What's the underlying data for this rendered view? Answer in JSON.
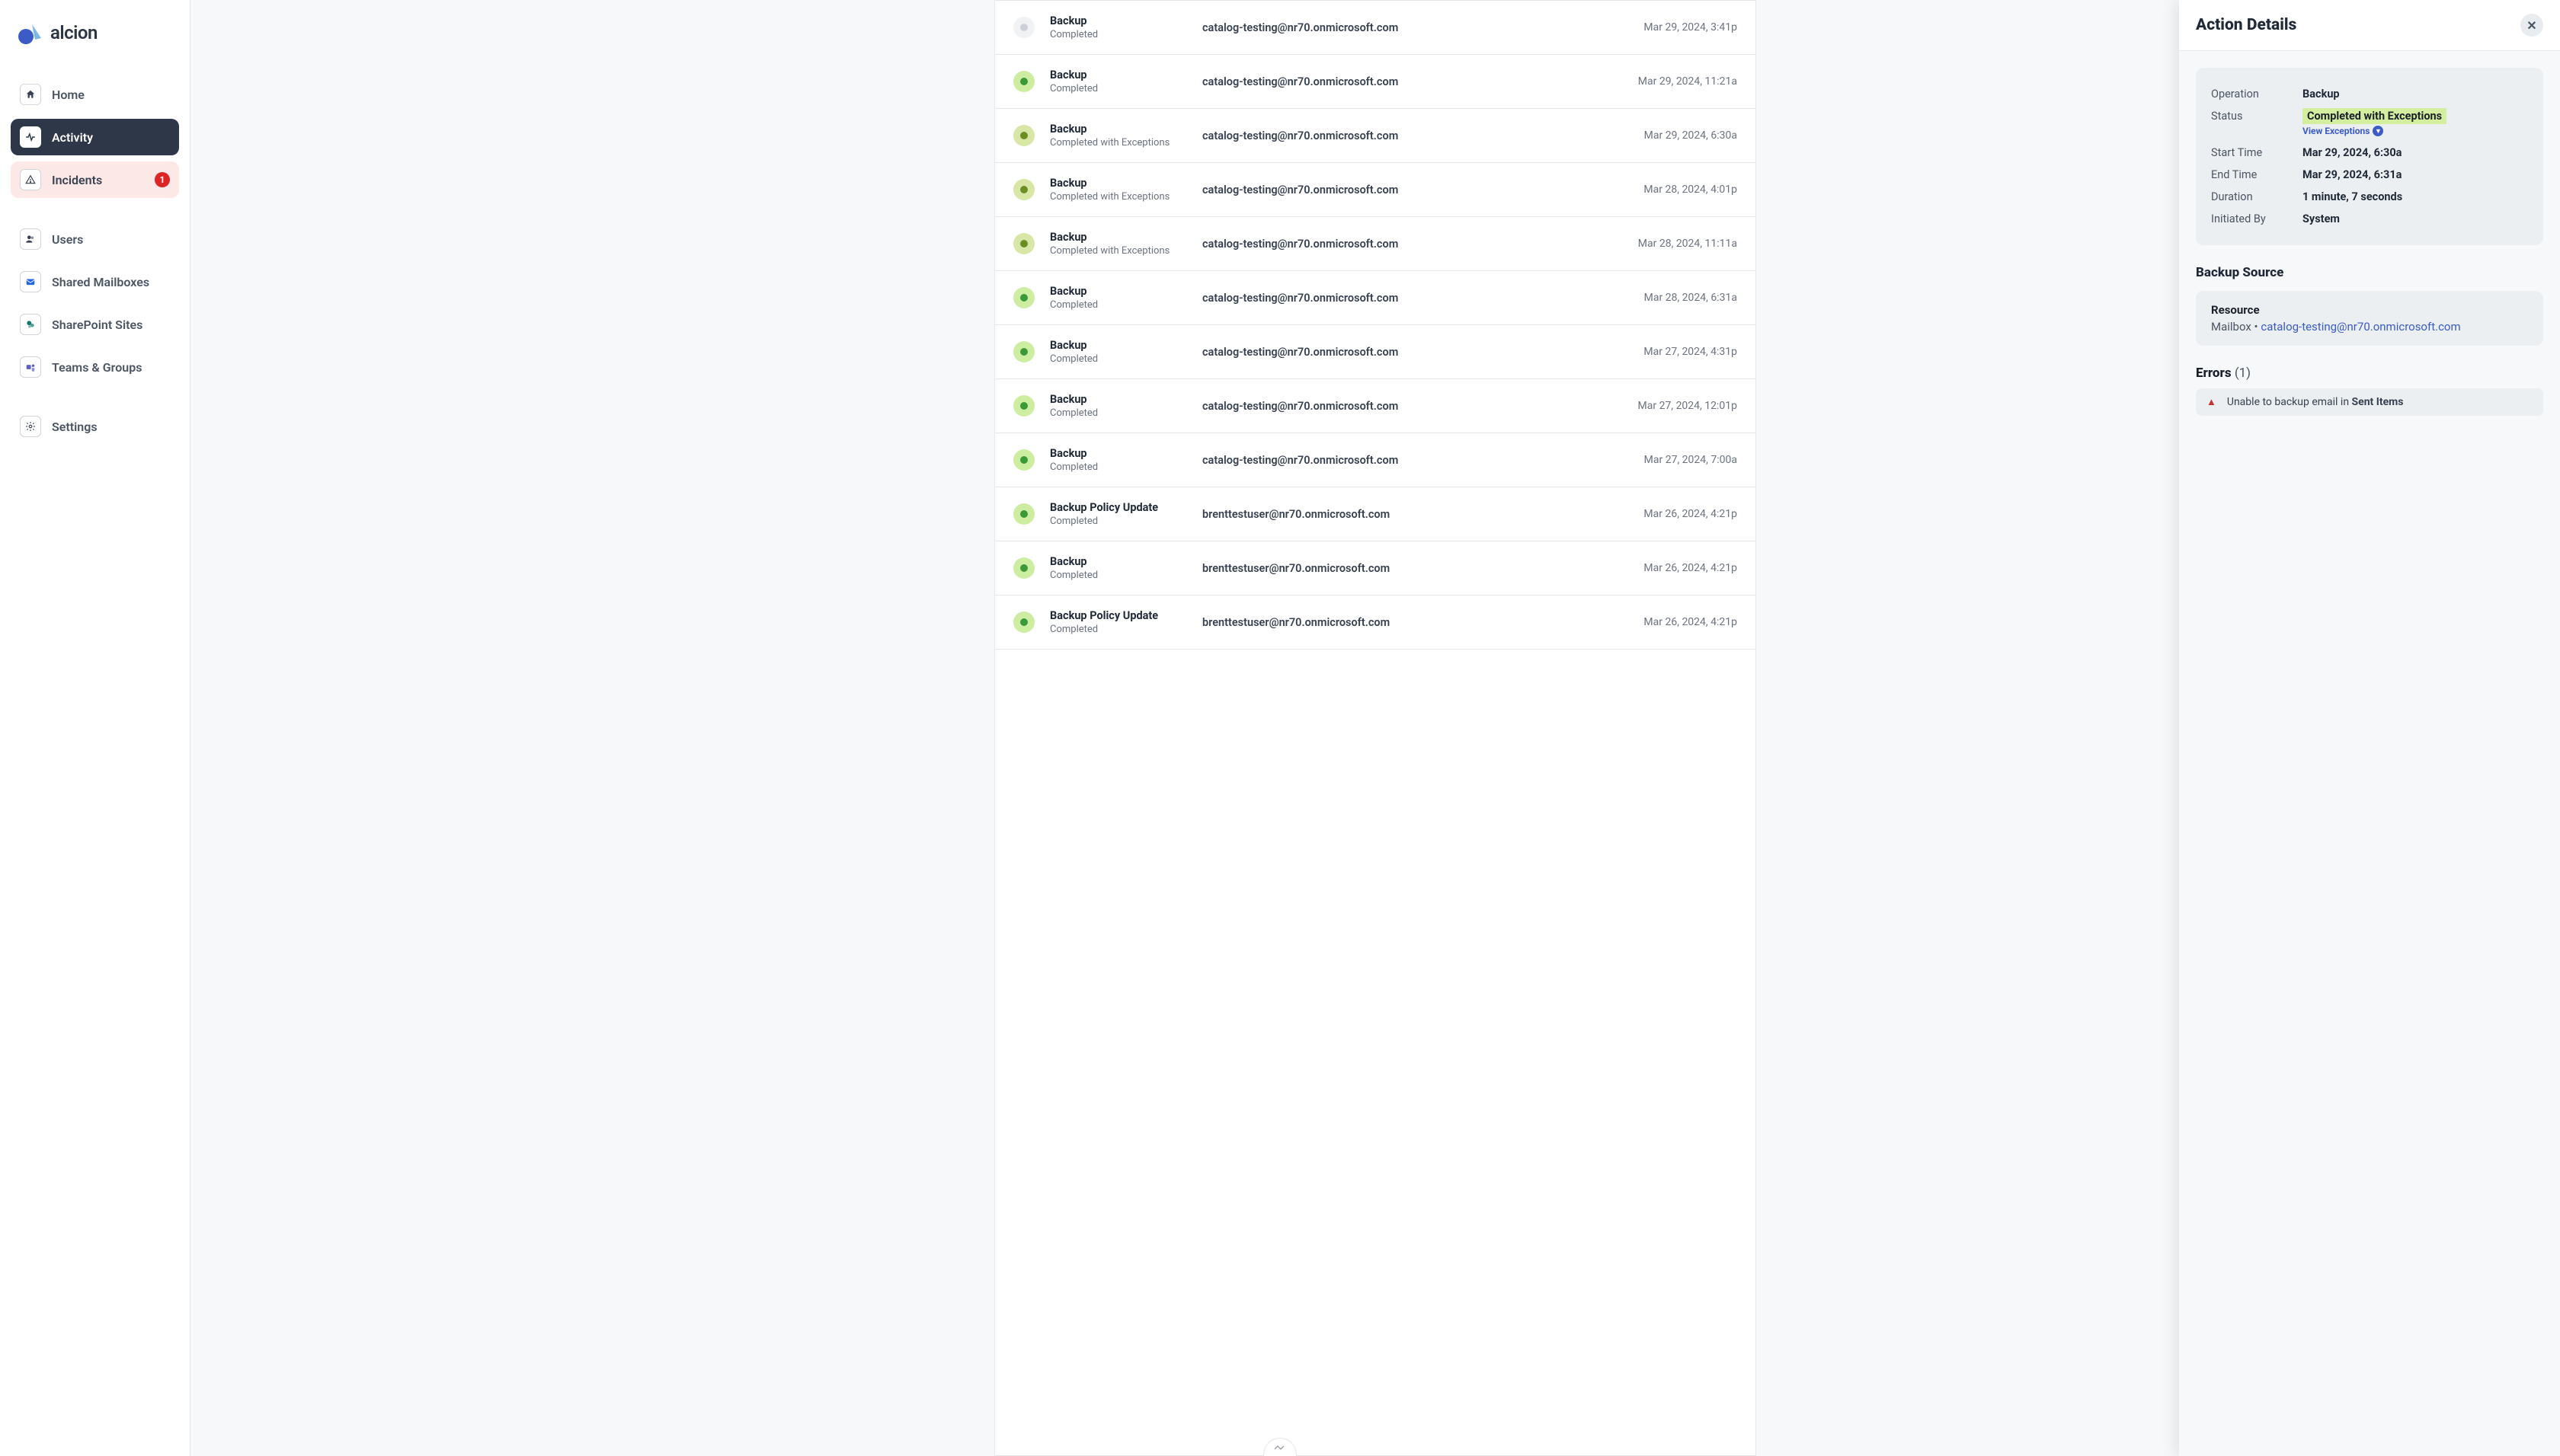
{
  "brand": "alcion",
  "sidebar": {
    "home": "Home",
    "activity": "Activity",
    "incidents": "Incidents",
    "incidents_badge": "1",
    "users": "Users",
    "shared_mailboxes": "Shared Mailboxes",
    "sharepoint_sites": "SharePoint Sites",
    "teams_groups": "Teams & Groups",
    "settings": "Settings"
  },
  "activity": [
    {
      "status": "faded",
      "title": "Backup",
      "subtitle": "Completed",
      "email": "catalog-testing@nr70.onmicrosoft.com",
      "time": "Mar 29, 2024, 3:41p"
    },
    {
      "status": "ok",
      "title": "Backup",
      "subtitle": "Completed",
      "email": "catalog-testing@nr70.onmicrosoft.com",
      "time": "Mar 29, 2024, 11:21a"
    },
    {
      "status": "warn",
      "title": "Backup",
      "subtitle": "Completed with Exceptions",
      "email": "catalog-testing@nr70.onmicrosoft.com",
      "time": "Mar 29, 2024, 6:30a"
    },
    {
      "status": "warn",
      "title": "Backup",
      "subtitle": "Completed with Exceptions",
      "email": "catalog-testing@nr70.onmicrosoft.com",
      "time": "Mar 28, 2024, 4:01p"
    },
    {
      "status": "warn",
      "title": "Backup",
      "subtitle": "Completed with Exceptions",
      "email": "catalog-testing@nr70.onmicrosoft.com",
      "time": "Mar 28, 2024, 11:11a"
    },
    {
      "status": "ok",
      "title": "Backup",
      "subtitle": "Completed",
      "email": "catalog-testing@nr70.onmicrosoft.com",
      "time": "Mar 28, 2024, 6:31a"
    },
    {
      "status": "ok",
      "title": "Backup",
      "subtitle": "Completed",
      "email": "catalog-testing@nr70.onmicrosoft.com",
      "time": "Mar 27, 2024, 4:31p"
    },
    {
      "status": "ok",
      "title": "Backup",
      "subtitle": "Completed",
      "email": "catalog-testing@nr70.onmicrosoft.com",
      "time": "Mar 27, 2024, 12:01p"
    },
    {
      "status": "ok",
      "title": "Backup",
      "subtitle": "Completed",
      "email": "catalog-testing@nr70.onmicrosoft.com",
      "time": "Mar 27, 2024, 7:00a"
    },
    {
      "status": "ok",
      "title": "Backup Policy Update",
      "subtitle": "Completed",
      "email": "brenttestuser@nr70.onmicrosoft.com",
      "time": "Mar 26, 2024, 4:21p"
    },
    {
      "status": "ok",
      "title": "Backup",
      "subtitle": "Completed",
      "email": "brenttestuser@nr70.onmicrosoft.com",
      "time": "Mar 26, 2024, 4:21p"
    },
    {
      "status": "ok",
      "title": "Backup Policy Update",
      "subtitle": "Completed",
      "email": "brenttestuser@nr70.onmicrosoft.com",
      "time": "Mar 26, 2024, 4:21p"
    }
  ],
  "drawer": {
    "title": "Action Details",
    "labels": {
      "operation": "Operation",
      "status": "Status",
      "start_time": "Start Time",
      "end_time": "End Time",
      "duration": "Duration",
      "initiated_by": "Initiated By"
    },
    "values": {
      "operation": "Backup",
      "status": "Completed with Exceptions",
      "view_exceptions": "View Exceptions",
      "start_time": "Mar 29, 2024, 6:30a",
      "end_time": "Mar 29, 2024, 6:31a",
      "duration": "1 minute, 7 seconds",
      "initiated_by": "System"
    },
    "backup_source_heading": "Backup Source",
    "resource_label": "Resource",
    "resource_type": "Mailbox",
    "resource_separator": " • ",
    "resource_email": "catalog-testing@nr70.onmicrosoft.com",
    "errors_heading": "Errors",
    "errors_count": "(1)",
    "error_prefix": "Unable to backup email in ",
    "error_strong": "Sent Items"
  }
}
